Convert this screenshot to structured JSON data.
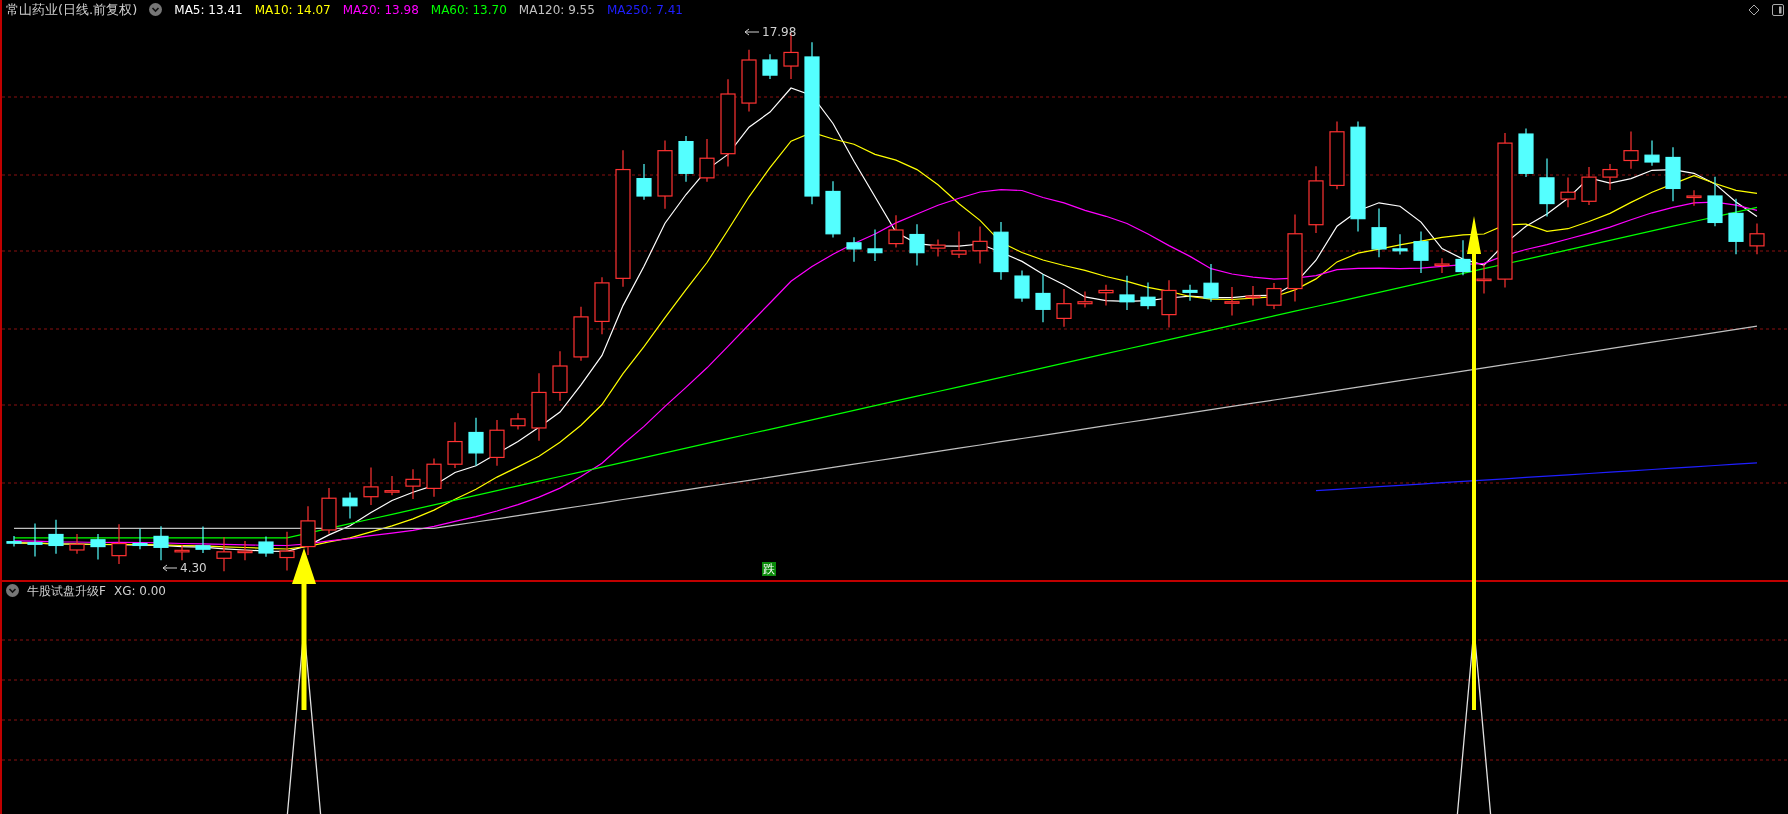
{
  "header": {
    "title": "常山药业(日线.前复权)",
    "moving_averages": [
      {
        "label": "MA5: 13.41",
        "color": "#ffffff"
      },
      {
        "label": "MA10: 14.07",
        "color": "#ffff00"
      },
      {
        "label": "MA20: 13.98",
        "color": "#ff00ff"
      },
      {
        "label": "MA60: 13.70",
        "color": "#00ff00"
      },
      {
        "label": "MA120: 9.55",
        "color": "#c0c0c0"
      },
      {
        "label": "MA250: 7.41",
        "color": "#1f1fff"
      }
    ]
  },
  "price_chart": {
    "high_label": "17.98",
    "low_label": "4.30",
    "marker": "跌"
  },
  "indicator_pane": {
    "title": "牛股试盘升级F",
    "reading": "XG: 0.00"
  }
}
